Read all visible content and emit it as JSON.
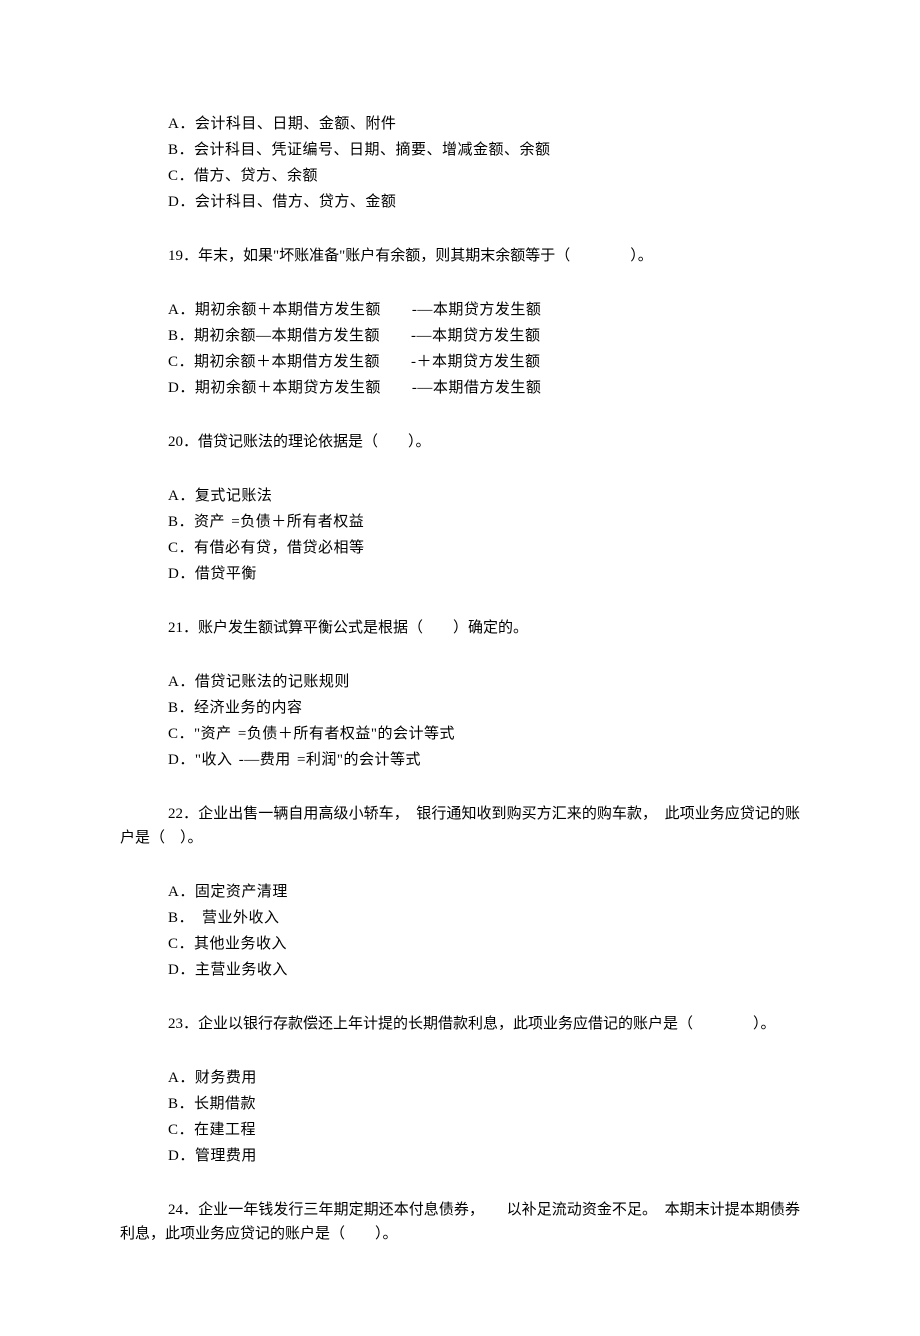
{
  "prev_options": {
    "A": "A．会计科目、日期、金额、附件",
    "B": "B．会计科目、凭证编号、日期、摘要、增减金额、余额",
    "C": "C．借方、贷方、余额",
    "D": "D．会计科目、借方、贷方、金额"
  },
  "q19": {
    "text": "19．年末，如果\"坏账准备\"账户有余额，则其期末余额等于（　　　　）。",
    "A": "A．期初余额＋本期借方发生额　　-—本期贷方发生额",
    "B": "B．期初余额—本期借方发生额　　-—本期贷方发生额",
    "C": "C．期初余额＋本期借方发生额　　-＋本期贷方发生额",
    "D": "D．期初余额＋本期贷方发生额　　-—本期借方发生额"
  },
  "q20": {
    "text": "20．借贷记账法的理论依据是（　　）。",
    "A": "A．复式记账法",
    "B": "B．资产 =负债＋所有者权益",
    "C": "C．有借必有贷，借贷必相等",
    "D": "D．借贷平衡"
  },
  "q21": {
    "text": "21．账户发生额试算平衡公式是根据（　　）确定的。",
    "A": "A．借贷记账法的记账规则",
    "B": "B．经济业务的内容",
    "C": "C．\"资产 =负债＋所有者权益\"的会计等式",
    "D": "D．\"收入 -—费用 =利润\"的会计等式"
  },
  "q22": {
    "text": "22．企业出售一辆自用高级小轿车，　银行通知收到购买方汇来的购车款，　此项业务应贷记的账户是（　）。",
    "A": "A．固定资产清理",
    "B": "B．　营业外收入",
    "C": "C．其他业务收入",
    "D": "D．主营业务收入"
  },
  "q23": {
    "text": "23．企业以银行存款偿还上年计提的长期借款利息，此项业务应借记的账户是（　　　　）。",
    "A": "A．财务费用",
    "B": "B．长期借款",
    "C": "C．在建工程",
    "D": "D．管理费用"
  },
  "q24": {
    "text": "24．企业一年钱发行三年期定期还本付息债券，　　以补足流动资金不足。　本期末计提本期债券利息，此项业务应贷记的账户是（　　）。"
  }
}
